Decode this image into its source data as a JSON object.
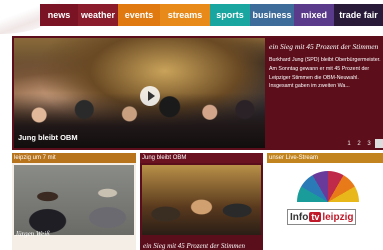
{
  "nav": {
    "items": [
      {
        "label": "news"
      },
      {
        "label": "weather"
      },
      {
        "label": "events"
      },
      {
        "label": "streams"
      },
      {
        "label": "sports"
      },
      {
        "label": "business"
      },
      {
        "label": "mixed"
      },
      {
        "label": "trade fair"
      }
    ]
  },
  "hero": {
    "caption": "Jung bleibt OBM",
    "side_title": "ein Sieg mit 45 Prozent der Stimmen",
    "side_text": "Burkhard Jung (SPD) bleibt Oberbürgermeister. Am Sonntag gewann er mit 45 Prozent der Leipziger Stimmen die OBM-Neuwahl. Insgesamt gaben im zweiten Wa...",
    "pager": [
      "1",
      "2",
      "3"
    ]
  },
  "panels": [
    {
      "header": "leipzig um 7 mit",
      "caption": "Jürgen Weiß"
    },
    {
      "header": "Jung bleibt OBM",
      "caption": "ein Sieg mit 45 Prozent der Stimmen"
    },
    {
      "header": "unser Live-Stream"
    }
  ],
  "logo": {
    "info": "Info",
    "tv": "tv",
    "city": "leipzig"
  }
}
